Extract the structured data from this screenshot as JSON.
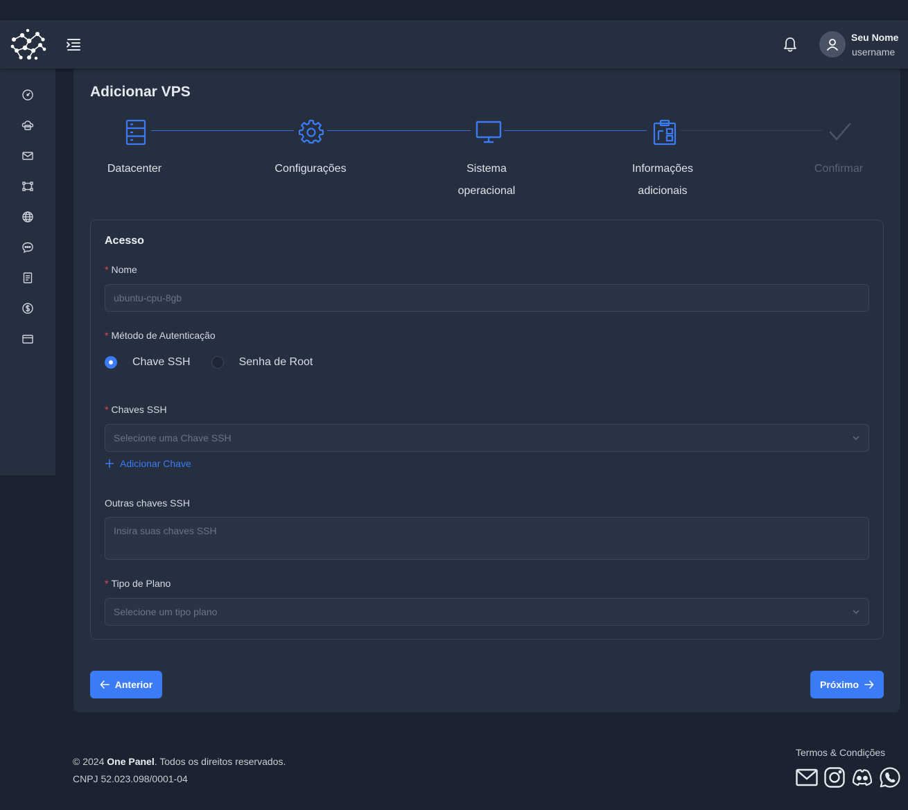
{
  "header": {
    "user_name": "Seu Nome",
    "user_handle": "username"
  },
  "sidebar": {
    "items": [
      {
        "icon": "dashboard-icon"
      },
      {
        "icon": "cloud-server-icon"
      },
      {
        "icon": "mail-icon"
      },
      {
        "icon": "network-icon"
      },
      {
        "icon": "globe-icon"
      },
      {
        "icon": "chat-icon"
      },
      {
        "icon": "document-icon"
      },
      {
        "icon": "dollar-icon"
      },
      {
        "icon": "credit-card-icon"
      }
    ]
  },
  "page": {
    "title": "Adicionar VPS"
  },
  "steps": [
    {
      "label_line1": "Datacenter",
      "label_line2": "",
      "icon": "server-icon",
      "state": "done"
    },
    {
      "label_line1": "Configurações",
      "label_line2": "",
      "icon": "gear-icon",
      "state": "done"
    },
    {
      "label_line1": "Sistema",
      "label_line2": "operacional",
      "icon": "monitor-icon",
      "state": "done"
    },
    {
      "label_line1": "Informações",
      "label_line2": "adicionais",
      "icon": "clipboard-icon",
      "state": "current"
    },
    {
      "label_line1": "Confirmar",
      "label_line2": "",
      "icon": "check-icon",
      "state": "pending"
    }
  ],
  "form": {
    "section_title": "Acesso",
    "name": {
      "label": "Nome",
      "placeholder": "ubuntu-cpu-8gb",
      "value": ""
    },
    "auth": {
      "label": "Método de Autenticação",
      "options": [
        "Chave SSH",
        "Senha de Root"
      ],
      "selected": "Chave SSH"
    },
    "ssh_keys": {
      "label": "Chaves SSH",
      "placeholder": "Selecione uma Chave SSH"
    },
    "add_key_label": "Adicionar Chave",
    "other_keys": {
      "label": "Outras chaves SSH",
      "placeholder": "Insira suas chaves SSH"
    },
    "plan_type": {
      "label": "Tipo de Plano",
      "placeholder": "Selecione um tipo plano"
    },
    "required_mark": "*"
  },
  "buttons": {
    "previous": "Anterior",
    "next": "Próximo"
  },
  "footer": {
    "copyright_prefix": "© 2024 ",
    "brand": "One Panel",
    "copyright_suffix": ". Todos os direitos reservados.",
    "cnpj": "CNPJ 52.023.098/0001-04",
    "terms": "Termos & Condições"
  },
  "colors": {
    "accent": "#3b7cf6",
    "background": "#1b2230",
    "surface": "#262f40",
    "required": "#e5484d"
  }
}
